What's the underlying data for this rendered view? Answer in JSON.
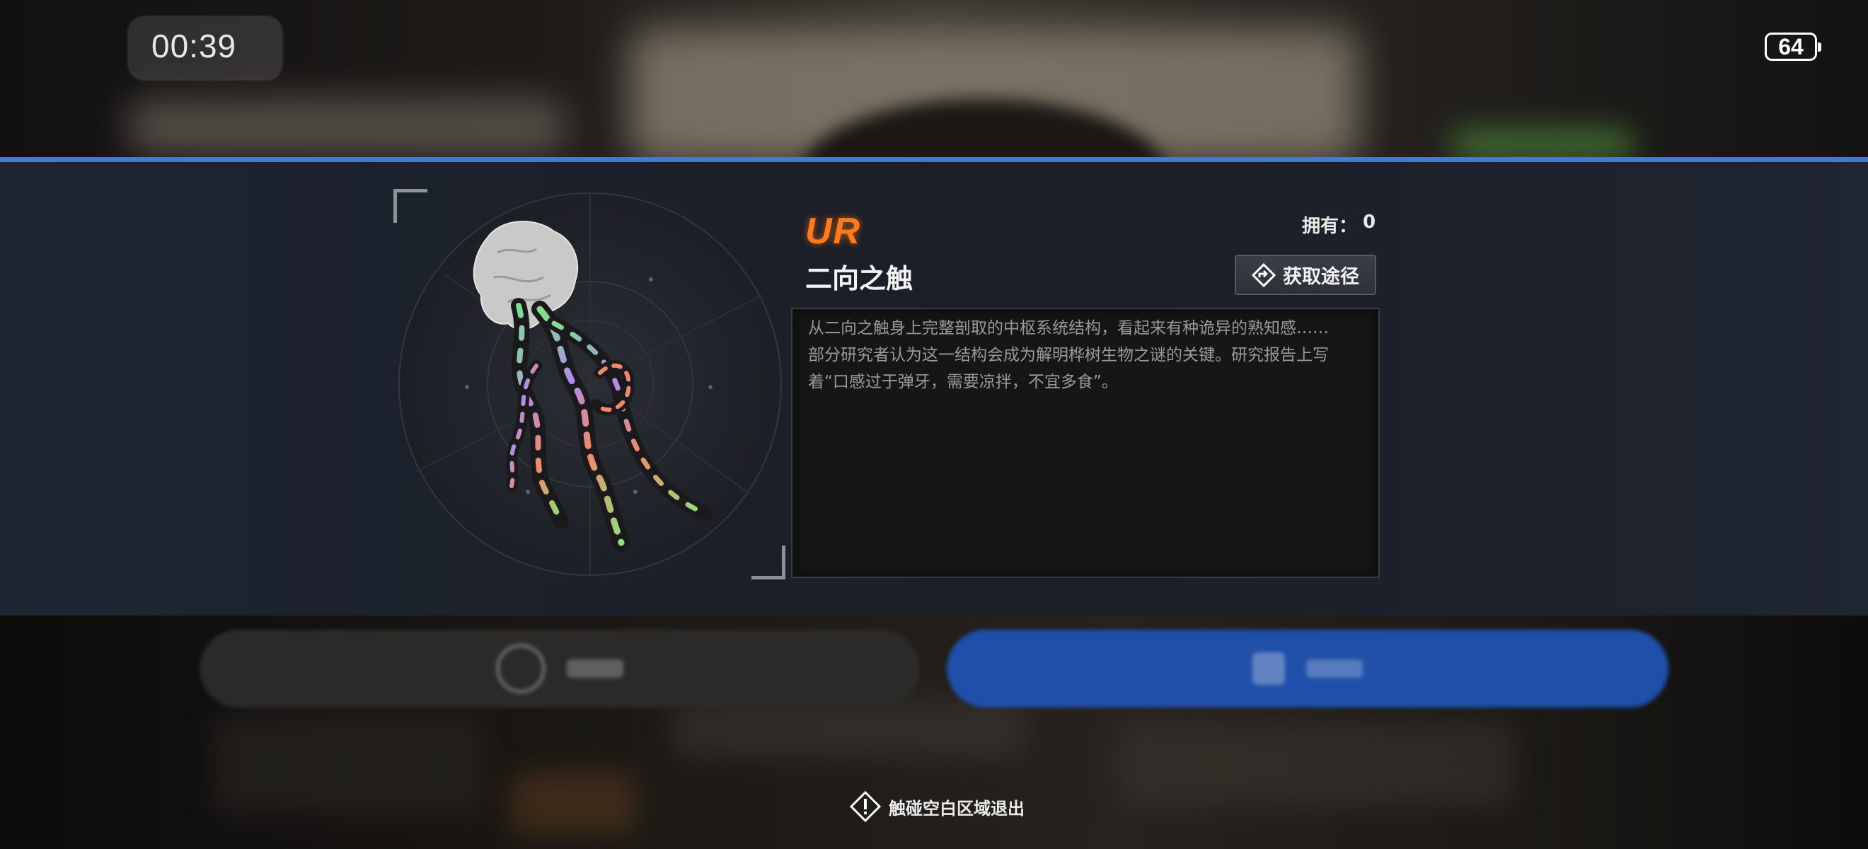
{
  "status_bar": {
    "time": "00:39",
    "battery_level": "64"
  },
  "item": {
    "rarity": "UR",
    "rarity_color": "#ff7a1a",
    "name": "二向之触",
    "owned_label": "拥有：",
    "owned_count": "0",
    "acquire_button_label": "获取途径",
    "acquire_icon": "diamond-arrow-icon",
    "description_lines": [
      "从二向之触身上完整剖取的中枢系统结构，看起来有种诡异的熟知感……",
      "部分研究者认为这一结构会成为解明桦树生物之谜的关键。研究报告上写",
      "着“口感过于弹牙，需要凉拌，不宜多食”。"
    ]
  },
  "exit_hint": {
    "icon": "warning-diamond-icon",
    "text": "触碰空白区域退出"
  },
  "colors": {
    "accent_blue": "#3c7ae0",
    "panel_bg": "#1b1f28"
  }
}
